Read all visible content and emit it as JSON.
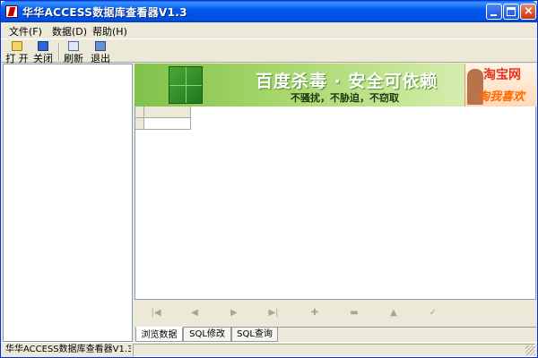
{
  "window": {
    "title": "华华ACCESS数据库查看器V1.3",
    "controls": {
      "minimize": "minimize",
      "maximize": "maximize",
      "close": "×"
    }
  },
  "menu": {
    "items": [
      {
        "label": "文件(F)"
      },
      {
        "label": "数据(D)"
      },
      {
        "label": "帮助(H)"
      }
    ]
  },
  "toolbar": {
    "buttons": [
      {
        "label": "打 开",
        "icon": "folder-open-icon"
      },
      {
        "label": "关闭",
        "icon": "close-db-icon"
      },
      {
        "label": "刷新",
        "icon": "refresh-icon"
      },
      {
        "label": "退出",
        "icon": "exit-icon"
      }
    ]
  },
  "banner": {
    "title": "百度杀毒 · 安全可依赖",
    "subtitle": "不骚扰，不胁迫，不窃取",
    "ad_title": "淘宝网",
    "ad_sub": "淘我喜欢",
    "colors": {
      "accent": "#7fc24a",
      "ad_red": "#e8341a",
      "ad_orange": "#ff6a00"
    }
  },
  "navigator": {
    "buttons": [
      "first-record",
      "prior-record",
      "next-record",
      "last-record",
      "insert-record",
      "delete-record",
      "edit-record",
      "post-edit"
    ]
  },
  "tabs": [
    {
      "label": "浏览数据",
      "active": true
    },
    {
      "label": "SQL修改",
      "active": false
    },
    {
      "label": "SQL查询",
      "active": false
    }
  ],
  "status": {
    "main": "华华ACCESS数据库查看器V1.3",
    "second": ""
  },
  "colors": {
    "titlebar": "#0058ee",
    "chrome": "#ece9d8",
    "border": "#7f9db9"
  }
}
